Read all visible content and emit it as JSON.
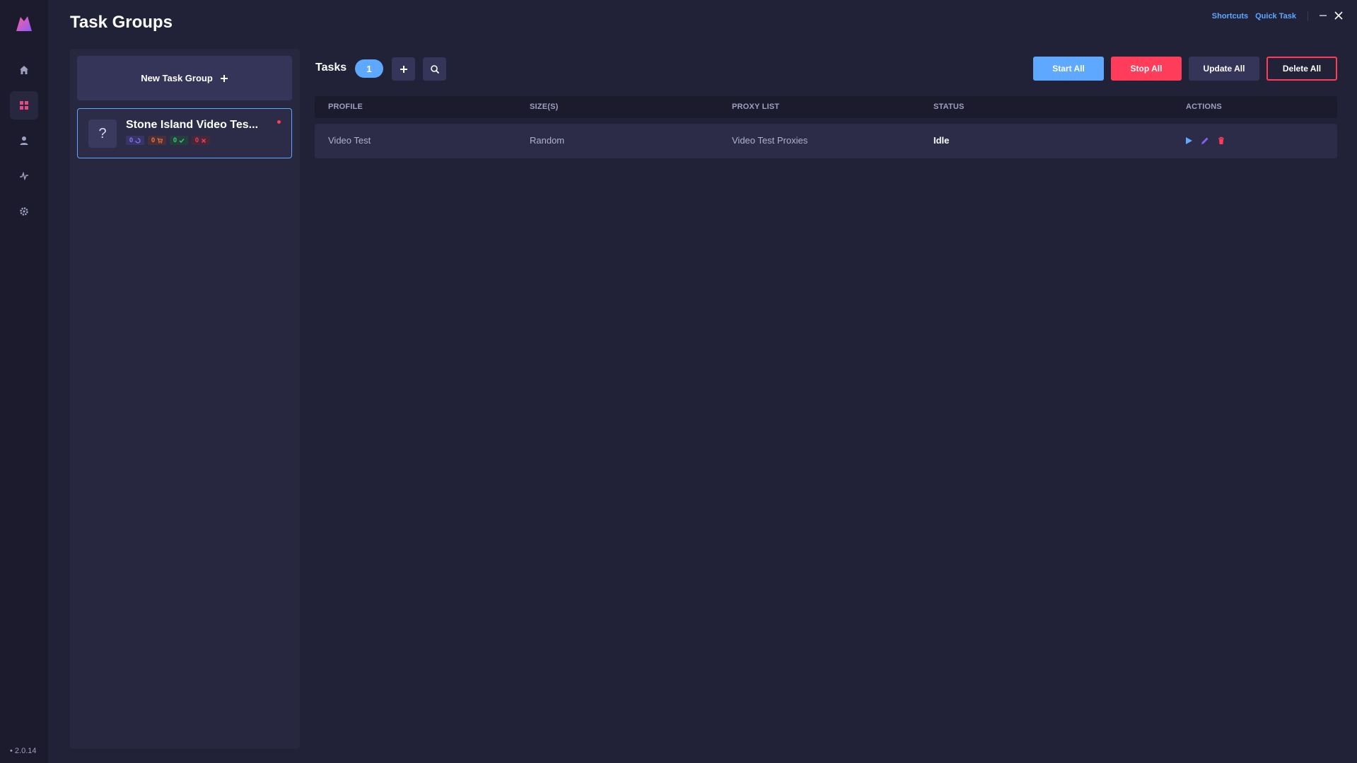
{
  "header": {
    "title": "Task Groups",
    "links": [
      "Shortcuts",
      "Quick Task"
    ]
  },
  "sidebar": {
    "version": "2.0.14",
    "items": [
      {
        "icon": "home-icon"
      },
      {
        "icon": "grid-icon",
        "active": true
      },
      {
        "icon": "user-icon"
      },
      {
        "icon": "activity-icon"
      },
      {
        "icon": "gear-icon"
      }
    ]
  },
  "groups": {
    "new_group_label": "New Task Group",
    "items": [
      {
        "avatar": "?",
        "name": "Stone Island Video Tes...",
        "counts": {
          "running": "0",
          "carted": "0",
          "success": "0",
          "failed": "0"
        }
      }
    ]
  },
  "tasks": {
    "title": "Tasks",
    "count": "1",
    "buttons": {
      "start_all": "Start All",
      "stop_all": "Stop All",
      "update_all": "Update All",
      "delete_all": "Delete All"
    },
    "columns": [
      "PROFILE",
      "SIZE(S)",
      "PROXY LIST",
      "STATUS",
      "ACTIONS"
    ],
    "rows": [
      {
        "profile": "Video Test",
        "sizes": "Random",
        "proxy_list": "Video Test Proxies",
        "status": "Idle"
      }
    ]
  },
  "colors": {
    "accent_blue": "#5ea9ff",
    "accent_red": "#ff3d5a",
    "accent_pink": "#e64a7e",
    "background": "#212137"
  }
}
